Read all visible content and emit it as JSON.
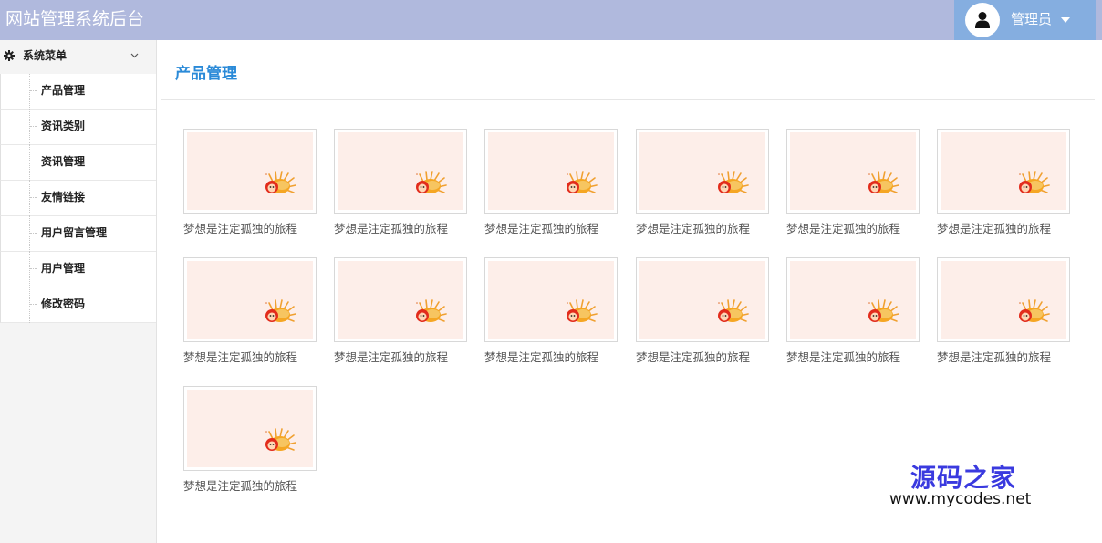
{
  "header": {
    "title": "网站管理系统后台",
    "user_name": "管理员",
    "accent_color": "#b0b9dd",
    "user_bg_color": "#85aee0"
  },
  "sidebar": {
    "menu_title": "系统菜单",
    "items": [
      {
        "label": "产品管理"
      },
      {
        "label": "资讯类别"
      },
      {
        "label": "资讯管理"
      },
      {
        "label": "友情链接"
      },
      {
        "label": "用户留言管理"
      },
      {
        "label": "用户管理"
      },
      {
        "label": "修改密码"
      }
    ]
  },
  "main": {
    "page_title": "产品管理",
    "products": [
      {
        "caption": "梦想是注定孤独的旅程"
      },
      {
        "caption": "梦想是注定孤独的旅程"
      },
      {
        "caption": "梦想是注定孤独的旅程"
      },
      {
        "caption": "梦想是注定孤独的旅程"
      },
      {
        "caption": "梦想是注定孤独的旅程"
      },
      {
        "caption": "梦想是注定孤独的旅程"
      },
      {
        "caption": "梦想是注定孤独的旅程"
      },
      {
        "caption": "梦想是注定孤独的旅程"
      },
      {
        "caption": "梦想是注定孤独的旅程"
      },
      {
        "caption": "梦想是注定孤独的旅程"
      },
      {
        "caption": "梦想是注定孤独的旅程"
      },
      {
        "caption": "梦想是注定孤独的旅程"
      },
      {
        "caption": "梦想是注定孤独的旅程"
      }
    ]
  },
  "watermark": {
    "title": "源码之家",
    "url": "www.mycodes.net"
  },
  "icons": {
    "user": "user-icon",
    "caret": "caret-down-icon",
    "gear": "gear-icon",
    "chevron": "chevron-down-icon",
    "thumbnail": "hedgehog-image"
  }
}
